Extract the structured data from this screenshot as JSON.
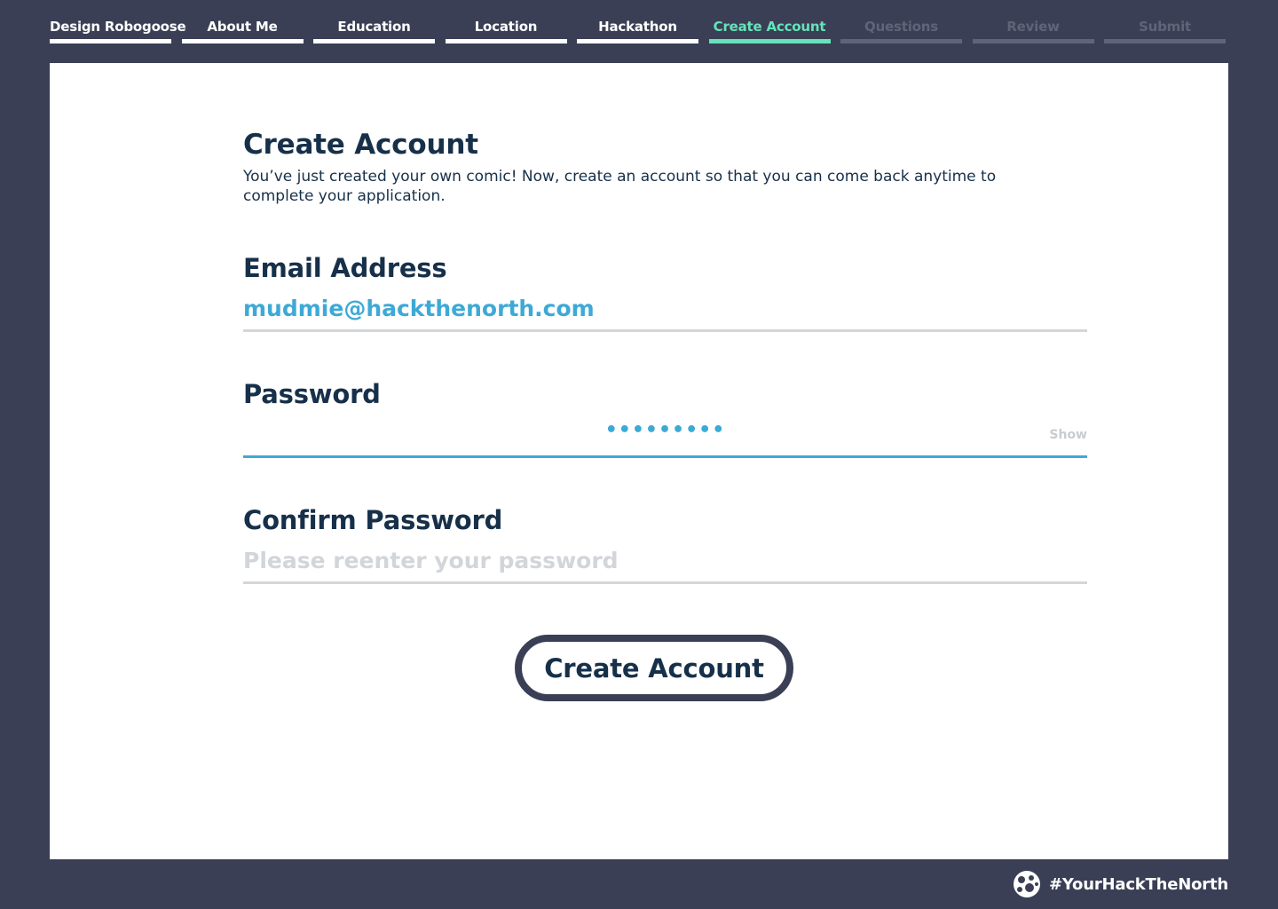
{
  "steps": [
    {
      "label": "Design Robogoose",
      "state": "done"
    },
    {
      "label": "About Me",
      "state": "done"
    },
    {
      "label": "Education",
      "state": "done"
    },
    {
      "label": "Location",
      "state": "done"
    },
    {
      "label": "Hackathon",
      "state": "done"
    },
    {
      "label": "Create Account",
      "state": "current"
    },
    {
      "label": "Questions",
      "state": "future"
    },
    {
      "label": "Review",
      "state": "future"
    },
    {
      "label": "Submit",
      "state": "future"
    }
  ],
  "form": {
    "title": "Create Account",
    "subtitle": "You’ve just created your own comic! Now, create an account so that you can come back anytime to complete your application.",
    "email": {
      "label": "Email Address",
      "value": "mudmie@hackthenorth.com"
    },
    "password": {
      "label": "Password",
      "masked_value": "•••••••••",
      "show_label": "Show"
    },
    "confirm": {
      "label": "Confirm Password",
      "placeholder": "Please reenter your password",
      "value": ""
    },
    "submit_label": "Create Account"
  },
  "footer": {
    "hashtag": "#YourHackTheNorth",
    "logo_icon": "hack-the-north-logo-icon"
  },
  "colors": {
    "background": "#3a3f55",
    "accent_green": "#65e3b9",
    "accent_blue": "#3ea9d6",
    "text_dark": "#17304a"
  }
}
